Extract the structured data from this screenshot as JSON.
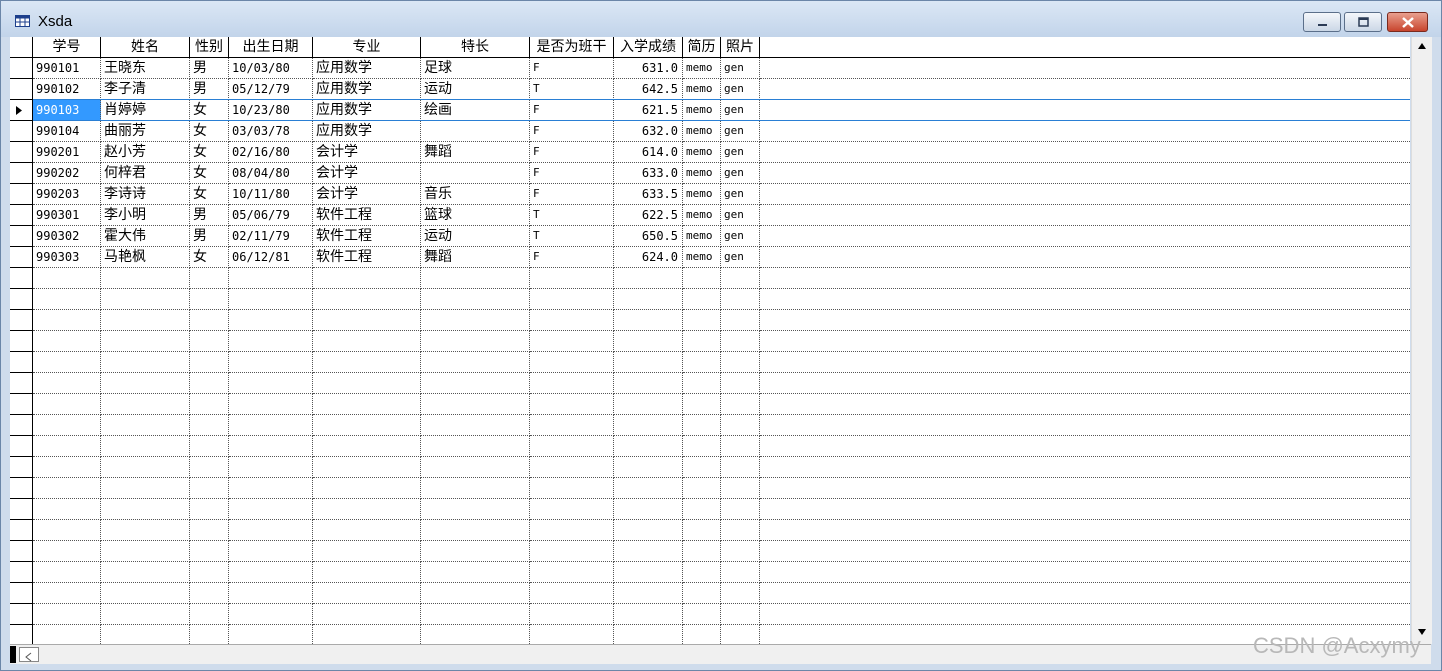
{
  "window": {
    "title": "Xsda"
  },
  "columns": [
    "学号",
    "姓名",
    "性别",
    "出生日期",
    "专业",
    "特长",
    "是否为班干",
    "入学成绩",
    "简历",
    "照片"
  ],
  "rows": [
    [
      "990101",
      "王晓东",
      "男",
      "10/03/80",
      "应用数学",
      "足球",
      "F",
      "631.0",
      "memo",
      "gen"
    ],
    [
      "990102",
      "李子清",
      "男",
      "05/12/79",
      "应用数学",
      "运动",
      "T",
      "642.5",
      "memo",
      "gen"
    ],
    [
      "990103",
      "肖婷婷",
      "女",
      "10/23/80",
      "应用数学",
      "绘画",
      "F",
      "621.5",
      "memo",
      "gen"
    ],
    [
      "990104",
      "曲丽芳",
      "女",
      "03/03/78",
      "应用数学",
      "",
      "F",
      "632.0",
      "memo",
      "gen"
    ],
    [
      "990201",
      "赵小芳",
      "女",
      "02/16/80",
      "会计学",
      "舞蹈",
      "F",
      "614.0",
      "memo",
      "gen"
    ],
    [
      "990202",
      "何梓君",
      "女",
      "08/04/80",
      "会计学",
      "",
      "F",
      "633.0",
      "memo",
      "gen"
    ],
    [
      "990203",
      "李诗诗",
      "女",
      "10/11/80",
      "会计学",
      "音乐",
      "F",
      "633.5",
      "memo",
      "gen"
    ],
    [
      "990301",
      "李小明",
      "男",
      "05/06/79",
      "软件工程",
      "篮球",
      "T",
      "622.5",
      "memo",
      "gen"
    ],
    [
      "990302",
      "霍大伟",
      "男",
      "02/11/79",
      "软件工程",
      "运动",
      "T",
      "650.5",
      "memo",
      "gen"
    ],
    [
      "990303",
      "马艳枫",
      "女",
      "06/12/81",
      "软件工程",
      "舞蹈",
      "F",
      "624.0",
      "memo",
      "gen"
    ]
  ],
  "selected_row": 2,
  "watermark": "CSDN @Acxymy"
}
